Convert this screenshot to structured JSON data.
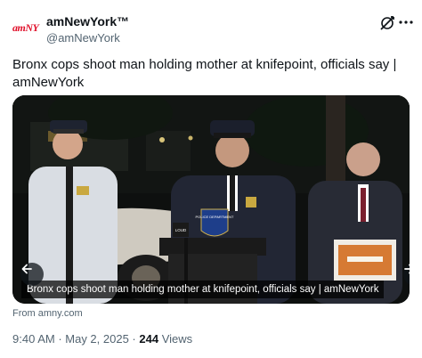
{
  "author": {
    "logo_text": "amNY",
    "name": "amNewYork™",
    "handle": "@amNewYork"
  },
  "tweet": {
    "text": "Bronx cops shoot man holding mother at knifepoint, officials say | amNewYork"
  },
  "card": {
    "caption": "Bronx cops shoot man holding mother at knifepoint, officials say | amNewYork",
    "from_label": "From amny.com",
    "podium_text": "POLICE DEPARTMENT",
    "sign_text": "LOUD"
  },
  "meta": {
    "time": "9:40 AM",
    "sep1": " · ",
    "date": "May 2, 2025",
    "sep2": " · ",
    "views_count": "244",
    "views_label": " Views"
  },
  "icons": {
    "grok": "grok-icon",
    "more": "more-icon",
    "prev": "arrow-left-icon",
    "next": "arrow-right-icon"
  },
  "colors": {
    "brand_red": "#e0112b",
    "text_primary": "#0f1419",
    "text_secondary": "#536471"
  }
}
